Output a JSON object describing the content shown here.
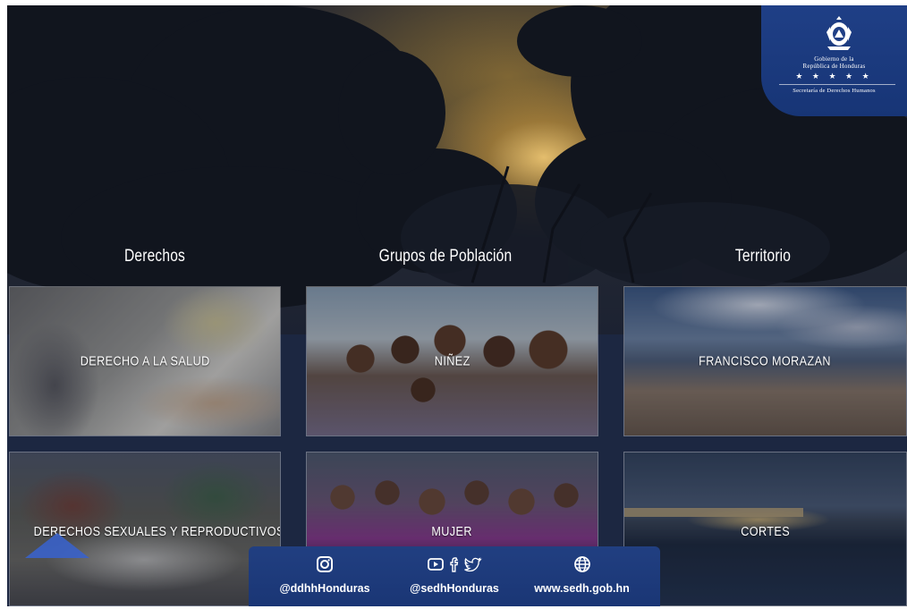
{
  "logo": {
    "gov_line1": "Gobierno de la",
    "gov_line2": "República de Honduras",
    "stars": "★ ★ ★ ★ ★",
    "secretaria": "Secretaría de Derechos Humanos",
    "icon": "coat-of-arms-seal"
  },
  "sections": {
    "derechos": "Derechos",
    "grupos": "Grupos de Población",
    "territorio": "Territorio"
  },
  "tiles": {
    "salud": "DERECHO A LA SALUD",
    "ninez": "NIÑEZ",
    "morazan": "FRANCISCO MORAZAN",
    "sexuales": "DERECHOS SEXUALES Y REPRODUCTIVOS",
    "mujer": "MUJER",
    "cortes": "CORTES"
  },
  "social": {
    "instagram": "@ddhhHonduras",
    "youtube_facebook_twitter": "@sedhHonduras",
    "website": "www.sedh.gob.hn",
    "icons": [
      "instagram-icon",
      "youtube-icon",
      "facebook-icon",
      "twitter-icon",
      "globe-icon"
    ]
  },
  "colors": {
    "badge_blue": "#1f3f86",
    "band_navy": "#1c2741"
  }
}
